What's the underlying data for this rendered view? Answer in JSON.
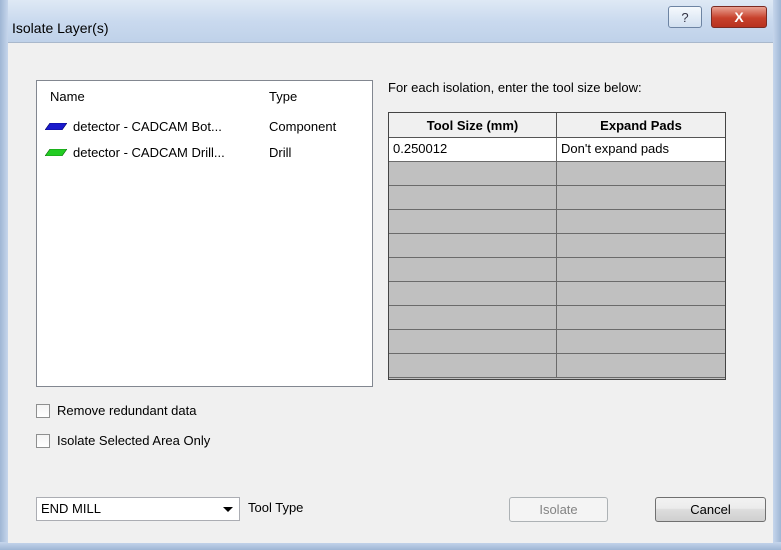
{
  "window": {
    "title": "Isolate Layer(s)",
    "help_glyph": "?",
    "close_glyph": "X"
  },
  "layers": {
    "columns": {
      "name": "Name",
      "type": "Type"
    },
    "rows": [
      {
        "name": "detector - CADCAM Bot...",
        "type": "Component",
        "color": "#1a1acc"
      },
      {
        "name": "detector - CADCAM Drill...",
        "type": "Drill",
        "color": "#22cc22"
      }
    ]
  },
  "isolation": {
    "label": "For each isolation, enter the tool size below:",
    "headers": {
      "tool_size": "Tool Size (mm)",
      "expand_pads": "Expand Pads"
    },
    "rows": [
      {
        "tool_size": "0.250012",
        "expand_pads": "Don't expand pads"
      },
      {
        "tool_size": "",
        "expand_pads": ""
      },
      {
        "tool_size": "",
        "expand_pads": ""
      },
      {
        "tool_size": "",
        "expand_pads": ""
      },
      {
        "tool_size": "",
        "expand_pads": ""
      },
      {
        "tool_size": "",
        "expand_pads": ""
      },
      {
        "tool_size": "",
        "expand_pads": ""
      },
      {
        "tool_size": "",
        "expand_pads": ""
      },
      {
        "tool_size": "",
        "expand_pads": ""
      },
      {
        "tool_size": "",
        "expand_pads": ""
      }
    ]
  },
  "options": {
    "remove_redundant": {
      "label": "Remove redundant data",
      "checked": false
    },
    "isolate_selected": {
      "label": "Isolate Selected Area Only",
      "checked": false
    }
  },
  "tool": {
    "selected": "END MILL",
    "label": "Tool Type"
  },
  "buttons": {
    "isolate": "Isolate",
    "cancel": "Cancel"
  }
}
